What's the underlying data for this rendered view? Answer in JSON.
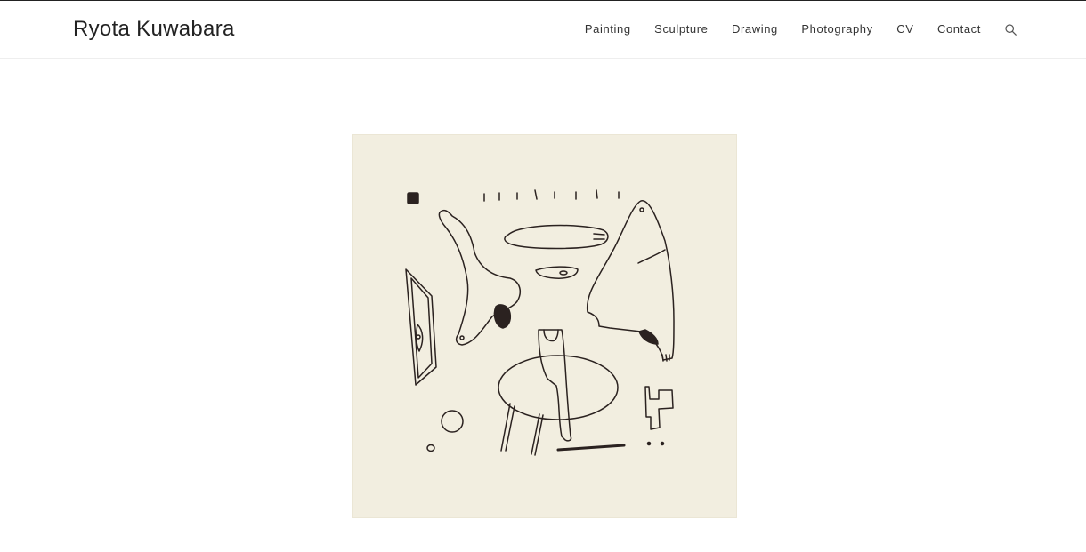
{
  "site": {
    "title": "Ryota Kuwabara"
  },
  "nav": {
    "items": [
      {
        "label": "Painting"
      },
      {
        "label": "Sculpture"
      },
      {
        "label": "Drawing"
      },
      {
        "label": "Photography"
      },
      {
        "label": "CV"
      },
      {
        "label": "Contact"
      }
    ],
    "search_icon": "search-icon"
  },
  "artwork": {
    "background_color": "#f2eee0",
    "ink_color": "#2b2220"
  }
}
